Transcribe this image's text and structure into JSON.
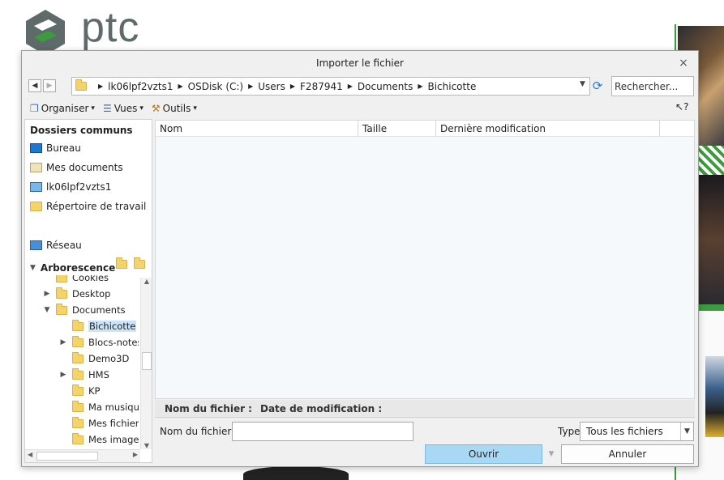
{
  "background": {
    "logo_text": "ptc",
    "accent": "#3c9b3c"
  },
  "dialog": {
    "title": "Importer le fichier",
    "close_glyph": "×"
  },
  "address": {
    "crumbs": [
      "lk06lpf2vzts1",
      "OSDisk (C:)",
      "Users",
      "F287941",
      "Documents",
      "Bichicotte"
    ],
    "search_placeholder": "Rechercher..."
  },
  "toolbar": {
    "organize": "Organiser",
    "views": "Vues",
    "tools": "Outils",
    "help_glyph": "?"
  },
  "common_folders": {
    "title": "Dossiers communs",
    "items": [
      "Bureau",
      "Mes documents",
      "lk06lpf2vzts1",
      "Répertoire de travail",
      "Réseau"
    ]
  },
  "tree": {
    "title": "Arborescence",
    "nodes": [
      {
        "label": "Cookies"
      },
      {
        "label": "Desktop"
      },
      {
        "label": "Documents"
      },
      {
        "label": "Bichicotte"
      },
      {
        "label": "Blocs-notes"
      },
      {
        "label": "Demo3D"
      },
      {
        "label": "HMS"
      },
      {
        "label": "KP"
      },
      {
        "label": "Ma musique"
      },
      {
        "label": "Mes fichiers"
      },
      {
        "label": "Mes images"
      }
    ]
  },
  "filelist": {
    "columns": [
      "Nom",
      "Taille",
      "Dernière modification"
    ]
  },
  "info": {
    "name_label": "Nom du fichier :",
    "date_label": "Date de modification :"
  },
  "footer": {
    "filename_label": "Nom du fichier :",
    "filename_value": "",
    "type_label": "Type",
    "type_value": "Tous les fichiers",
    "open_button": "Ouvrir",
    "cancel_button": "Annuler"
  }
}
